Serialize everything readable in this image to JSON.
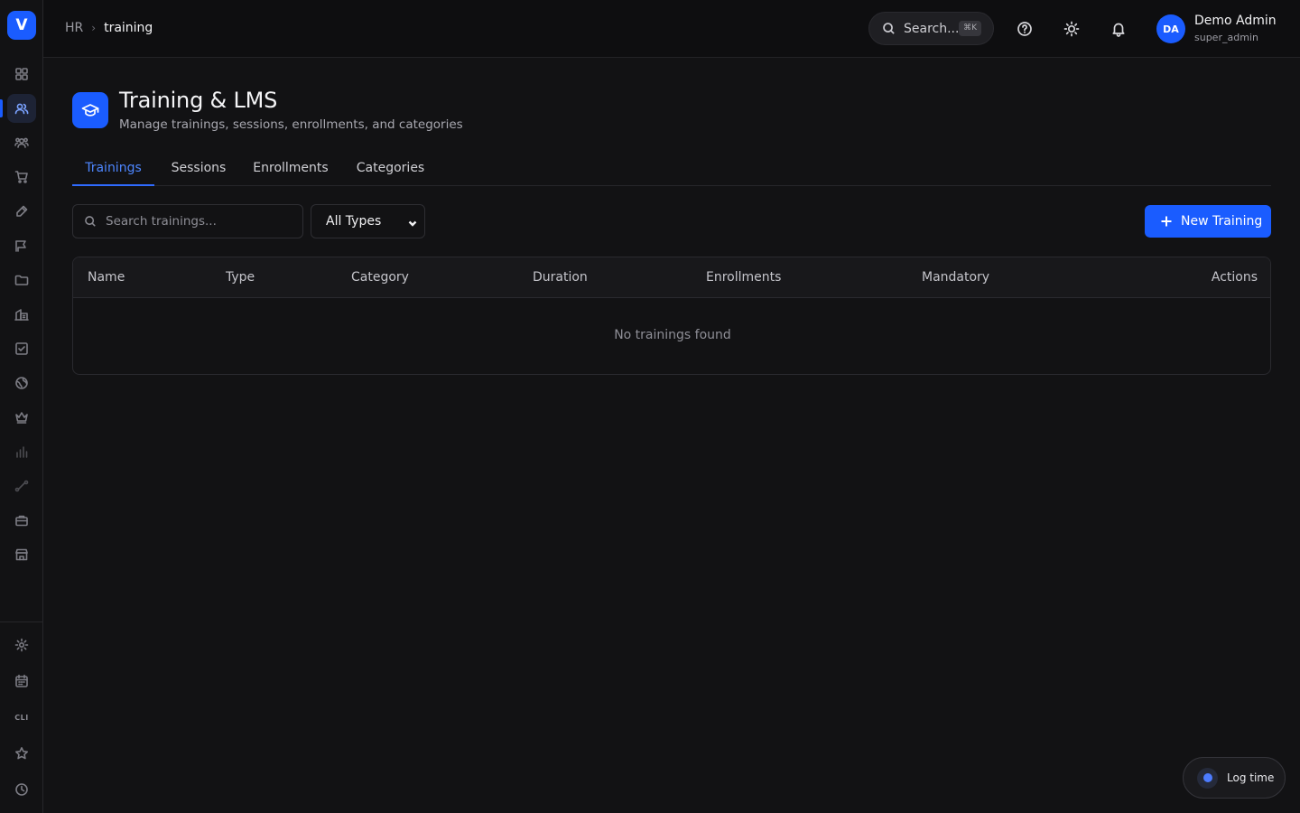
{
  "app": {
    "logo_letter": "V",
    "brand_color": "#1a5cff"
  },
  "sidebar": {
    "items": [
      {
        "icon": "dashboard-icon",
        "active": false
      },
      {
        "icon": "users-icon",
        "active": true
      },
      {
        "icon": "team-icon",
        "active": false
      },
      {
        "icon": "cart-icon",
        "active": false
      },
      {
        "icon": "pen-icon",
        "active": false
      },
      {
        "icon": "campaign-icon",
        "active": false
      },
      {
        "icon": "folder-icon",
        "active": false
      },
      {
        "icon": "building-icon",
        "active": false
      },
      {
        "icon": "checkbox-icon",
        "active": false
      },
      {
        "icon": "globe-icon",
        "active": false
      },
      {
        "icon": "crown-icon",
        "active": false
      },
      {
        "icon": "bar-chart-icon",
        "active": false
      },
      {
        "icon": "route-icon",
        "active": false
      },
      {
        "icon": "briefcase-icon",
        "active": false
      },
      {
        "icon": "store-icon",
        "active": false
      }
    ],
    "bottom": {
      "cli_label": "CLI",
      "icons": [
        "settings-icon",
        "calendar-icon",
        "cli-icon",
        "star-icon",
        "clock-icon"
      ]
    }
  },
  "header": {
    "breadcrumb": {
      "root": "HR",
      "current": "training"
    },
    "search": {
      "label": "Search...",
      "shortcut": "⌘K"
    },
    "user": {
      "initials": "DA",
      "name": "Demo Admin",
      "role": "super_admin"
    }
  },
  "page": {
    "title": "Training & LMS",
    "subtitle": "Manage trainings, sessions, enrollments, and categories",
    "tabs": [
      {
        "label": "Trainings",
        "active": true
      },
      {
        "label": "Sessions",
        "active": false
      },
      {
        "label": "Enrollments",
        "active": false
      },
      {
        "label": "Categories",
        "active": false
      }
    ],
    "toolbar": {
      "search_placeholder": "Search trainings...",
      "type_filter": "All Types",
      "new_button": "New Training"
    },
    "table": {
      "columns": [
        "Name",
        "Type",
        "Category",
        "Duration",
        "Enrollments",
        "Mandatory",
        "Actions"
      ],
      "empty_message": "No trainings found"
    }
  },
  "floating": {
    "log_time_label": "Log time"
  }
}
